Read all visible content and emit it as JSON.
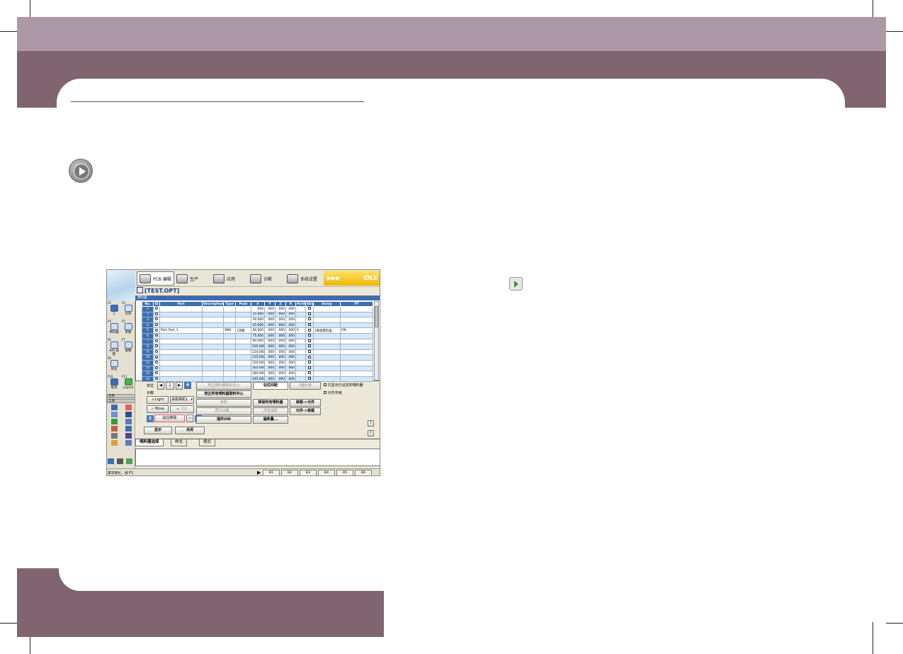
{
  "screenshot": {
    "modes": [
      {
        "label": "PCB 编辑",
        "active": true
      },
      {
        "label": "生产",
        "active": false
      },
      {
        "label": "应用",
        "active": false
      },
      {
        "label": "诊断",
        "active": false
      },
      {
        "label": "系统设置",
        "active": false
      }
    ],
    "status_indicator": {
      "arrows": "▶▶▶",
      "label": "IDLE"
    },
    "file_title": "[TEST.OPT]",
    "grid_window_title": "喂料器",
    "function_keys": [
      {
        "key": "F2",
        "label": "1"
      },
      {
        "key": "F3",
        "label": "文件"
      },
      {
        "key": "F4",
        "label": "供料器"
      },
      {
        "key": "F5",
        "label": "参数"
      },
      {
        "key": "F6",
        "label": "ARC调整"
      },
      {
        "key": "F7",
        "label": "观察"
      },
      {
        "key": "F8",
        "label": "优化"
      },
      {
        "key": "F10",
        "label": "取消"
      },
      {
        "key": "F11",
        "label": "Layout"
      }
    ],
    "rail_dropdowns": [
      "文件",
      "工具"
    ],
    "columns": [
      "No.",
      "ID",
      "Part",
      "Description",
      "Type",
      "Push",
      "X",
      "Y",
      "Z",
      "R",
      "PartR",
      "Skip",
      "Dump",
      "PT"
    ],
    "rows": [
      {
        "no": "1",
        "part": "",
        "type": "",
        "push": "",
        "x": ".000",
        "y": ".000",
        "z": ".000",
        "r": ".000",
        "partr": "",
        "dump": "",
        "pt": ""
      },
      {
        "no": "2",
        "part": "",
        "type": "",
        "push": "",
        "x": "15.000",
        "y": ".000",
        "z": ".000",
        "r": ".000",
        "partr": "",
        "dump": "",
        "pt": ""
      },
      {
        "no": "3",
        "part": "",
        "type": "",
        "push": "",
        "x": "30.000",
        "y": ".000",
        "z": ".000",
        "r": ".000",
        "partr": "",
        "dump": "",
        "pt": ""
      },
      {
        "no": "4",
        "part": "",
        "type": "",
        "push": "",
        "x": "45.000",
        "y": ".000",
        "z": ".000",
        "r": ".000",
        "partr": "",
        "dump": "",
        "pt": ""
      },
      {
        "no": "5",
        "part": "Part_Part_1",
        "type": "SMII",
        "push": "1次数",
        "x": "60.000",
        "y": ".000",
        "z": ".000",
        "r": ".000",
        "partr": "0",
        "dump": "1系统废料盒",
        "pt": "ON"
      },
      {
        "no": "6",
        "part": "",
        "type": "",
        "push": "",
        "x": "75.000",
        "y": ".000",
        "z": ".000",
        "r": ".000",
        "partr": "",
        "dump": "",
        "pt": ""
      },
      {
        "no": "7",
        "part": "",
        "type": "",
        "push": "",
        "x": "90.000",
        "y": ".000",
        "z": ".000",
        "r": ".000",
        "partr": "",
        "dump": "",
        "pt": ""
      },
      {
        "no": "8",
        "part": "",
        "type": "",
        "push": "",
        "x": "105.000",
        "y": ".000",
        "z": ".000",
        "r": ".000",
        "partr": "",
        "dump": "",
        "pt": ""
      },
      {
        "no": "9",
        "part": "",
        "type": "",
        "push": "",
        "x": "120.000",
        "y": ".000",
        "z": ".000",
        "r": ".000",
        "partr": "",
        "dump": "",
        "pt": ""
      },
      {
        "no": "10",
        "part": "",
        "type": "",
        "push": "",
        "x": "135.000",
        "y": ".000",
        "z": ".000",
        "r": ".000",
        "partr": "",
        "dump": "",
        "pt": ""
      },
      {
        "no": "11",
        "part": "",
        "type": "",
        "push": "",
        "x": "150.000",
        "y": ".000",
        "z": ".000",
        "r": ".000",
        "partr": "",
        "dump": "",
        "pt": ""
      },
      {
        "no": "12",
        "part": "",
        "type": "",
        "push": "",
        "x": "165.000",
        "y": ".000",
        "z": ".000",
        "r": ".000",
        "partr": "",
        "dump": "",
        "pt": ""
      },
      {
        "no": "13",
        "part": "",
        "type": "",
        "push": "",
        "x": "180.000",
        "y": ".000",
        "z": ".000",
        "r": ".000",
        "partr": "",
        "dump": "",
        "pt": ""
      },
      {
        "no": "14",
        "part": "",
        "type": "",
        "push": "",
        "x": "195.000",
        "y": ".000",
        "z": ".000",
        "r": ".000",
        "partr": "",
        "dump": "",
        "pt": ""
      }
    ],
    "controls": {
      "unit_label": "单位",
      "unit_value": "1",
      "tag4": "4",
      "tag2": "2",
      "tag3": "3",
      "teach_label": "示教",
      "light_label": "Light",
      "camera_value": "桌载相机1",
      "move_label": "Move",
      "ctrl_label": "Ctrl",
      "btn_correct_center": "校正喂料器取料中心",
      "btn_correct_all": "校正所有喂料器取料中心",
      "btn_gap": "站位间距",
      "btn_teach3": "3轴示教",
      "btn_param": "参数",
      "btn_remove_all": "移除所有喂料器",
      "btn_feeder_to_part": "装载->元件",
      "btn_open_teach": "再示示教...",
      "btn_change_pickup": "改变拾取",
      "btn_part_to_feeder": "元件->装载",
      "btn_move_pos": "站位移除",
      "btn_part_uid": "插件UID",
      "btn_offset": "偏移量...",
      "btn_show": "显示",
      "btn_close": "关闭",
      "chk_only_set": "只显示已设定的喂料器",
      "chk_part_shared": "元件共用"
    },
    "tabs": [
      {
        "label": "喂料器选择",
        "active": true
      },
      {
        "label": "样式",
        "active": false
      },
      {
        "label": "喂式",
        "active": false
      }
    ],
    "status_text": "需求帮忙，按 F1",
    "status_cells": [
      "B1",
      "B2",
      "B3",
      "B4",
      "B5",
      "B6"
    ]
  }
}
